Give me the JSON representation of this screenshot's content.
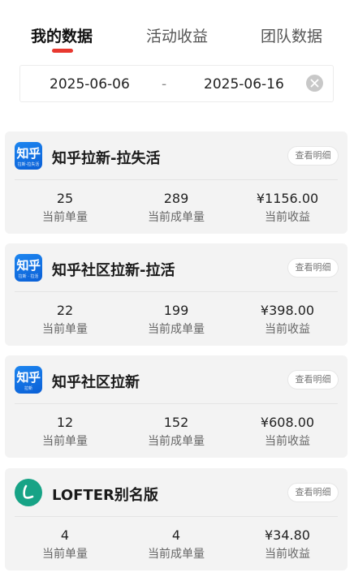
{
  "tabs": [
    {
      "label": "我的数据",
      "active": true
    },
    {
      "label": "活动收益",
      "active": false
    },
    {
      "label": "团队数据",
      "active": false
    }
  ],
  "date_range": {
    "start": "2025-06-06",
    "separator": "-",
    "end": "2025-06-16"
  },
  "colors": {
    "accent": "#e8382f",
    "zhihu_blue": "#1d86f0",
    "lofter_green": "#17a386"
  },
  "stat_labels": {
    "orders": "当前单量",
    "completed": "当前成单量",
    "earnings": "当前收益"
  },
  "cards": [
    {
      "title": "知乎拉新-拉失活",
      "logo": {
        "main": "知乎",
        "sub": "拉新-拉失活",
        "icon": "zhihu-logo-icon"
      },
      "detail_label": "查看明细",
      "orders": "25",
      "completed": "289",
      "earnings": "¥1156.00"
    },
    {
      "title": "知乎社区拉新-拉活",
      "logo": {
        "main": "知乎",
        "sub": "拉新 · 拉活",
        "icon": "zhihu-logo-icon"
      },
      "detail_label": "查看明细",
      "orders": "22",
      "completed": "199",
      "earnings": "¥398.00"
    },
    {
      "title": "知乎社区拉新",
      "logo": {
        "main": "知乎",
        "sub": "拉新",
        "icon": "zhihu-logo-icon"
      },
      "detail_label": "查看明细",
      "orders": "12",
      "completed": "152",
      "earnings": "¥608.00"
    },
    {
      "title": "LOFTER别名版",
      "logo": {
        "icon": "lofter-logo-icon"
      },
      "detail_label": "查看明细",
      "orders": "4",
      "completed": "4",
      "earnings": "¥34.80"
    }
  ]
}
